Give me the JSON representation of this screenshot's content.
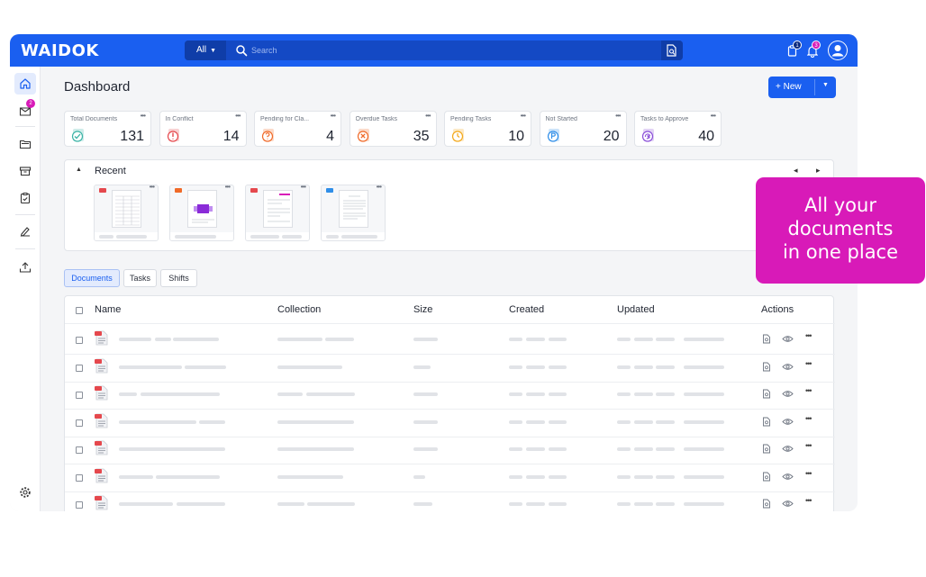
{
  "app": {
    "logo": "WAIDOK"
  },
  "search": {
    "scope": "All",
    "placeholder": "Search"
  },
  "header": {
    "tasks_badge": "1",
    "notifications_badge": "3"
  },
  "sidebar": {
    "inbox_badge": "2"
  },
  "page": {
    "title": "Dashboard",
    "new_button": "New"
  },
  "stats": [
    {
      "label": "Total Documents",
      "value": "131",
      "color": "#3bb3a6"
    },
    {
      "label": "In Conflict",
      "value": "14",
      "color": "#e5484d"
    },
    {
      "label": "Pending for Cla...",
      "value": "4",
      "color": "#f06a28"
    },
    {
      "label": "Overdue Tasks",
      "value": "35",
      "color": "#f06a28"
    },
    {
      "label": "Pending Tasks",
      "value": "10",
      "color": "#f3a81a"
    },
    {
      "label": "Not Started",
      "value": "20",
      "color": "#2f8ee8"
    },
    {
      "label": "Tasks to Approve",
      "value": "40",
      "color": "#8a4fd8"
    }
  ],
  "recent": {
    "title": "Recent"
  },
  "tabs": [
    "Documents",
    "Tasks",
    "Shifts"
  ],
  "table": {
    "columns": [
      "Name",
      "Collection",
      "Size",
      "Created",
      "Updated",
      "Actions"
    ]
  },
  "promo": {
    "line1": "All your",
    "line2": "documents",
    "line3": "in one place"
  },
  "colors": {
    "brand": "#1a5ff0",
    "promo": "#d81ab8"
  }
}
